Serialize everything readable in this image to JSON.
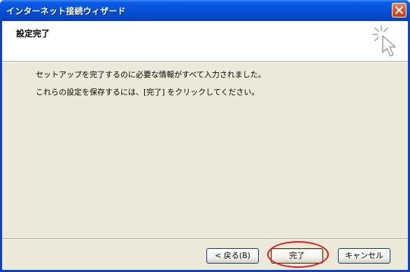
{
  "window": {
    "title": "インターネット接続ウィザード"
  },
  "header": {
    "title": "設定完了",
    "icon": "wizard-sparkle-cursor-icon"
  },
  "body": {
    "line1": "セットアップを完了するのに必要な情報がすべて入力されました。",
    "line2": "これらの設定を保存するには、[完了] をクリックしてください。"
  },
  "buttons": {
    "back": "< 戻る(B)",
    "finish": "完了",
    "cancel": "キャンセル"
  },
  "colors": {
    "titlebar": "#0651d6",
    "dialog_bg": "#ece9d8",
    "highlight": "#e8141a"
  }
}
